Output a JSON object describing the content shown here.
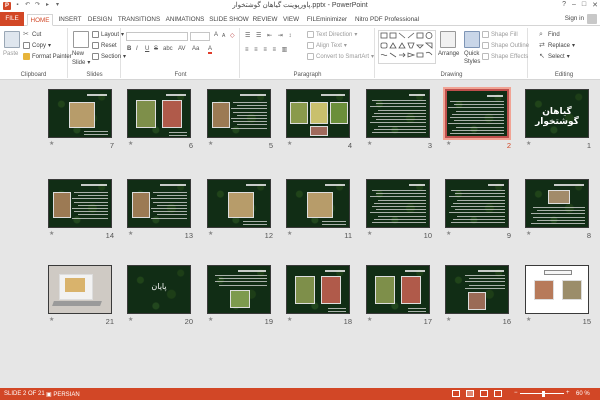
{
  "window": {
    "title": "پاورپوینت گیاهان گوشتخوار.pptx - PowerPoint",
    "controls": [
      "?",
      "–",
      "□",
      "✕"
    ]
  },
  "tabs": {
    "items": [
      "FILE",
      "HOME",
      "INSERT",
      "DESIGN",
      "TRANSITIONS",
      "ANIMATIONS",
      "SLIDE SHOW",
      "REVIEW",
      "VIEW",
      "FILEminimizer",
      "Nitro PDF Professional"
    ],
    "active": "HOME",
    "sign_in": "Sign in"
  },
  "ribbon": {
    "clipboard": {
      "label": "Clipboard",
      "paste": "Paste",
      "cut": "Cut",
      "copy": "Copy",
      "format_painter": "Format Painter"
    },
    "slides": {
      "label": "Slides",
      "new_slide": "New",
      "new_slide2": "Slide",
      "layout": "Layout",
      "reset": "Reset",
      "section": "Section"
    },
    "font": {
      "label": "Font",
      "bold": "B",
      "italic": "I",
      "underline": "U",
      "strike": "S",
      "shadow": "abc",
      "aa": "AV",
      "case": "Aa",
      "grow": "A",
      "shrink": "A"
    },
    "paragraph": {
      "label": "Paragraph",
      "text_direction": "Text Direction",
      "align_text": "Align Text",
      "smartart": "Convert to SmartArt"
    },
    "drawing": {
      "label": "Drawing",
      "arrange": "Arrange",
      "quick_styles": "Quick",
      "quick_styles2": "Styles",
      "shape_fill": "Shape Fill",
      "shape_outline": "Shape Outline",
      "shape_effects": "Shape Effects"
    },
    "editing": {
      "label": "Editing",
      "find": "Find",
      "replace": "Replace",
      "select": "Select"
    }
  },
  "slides": [
    {
      "n": "1",
      "kind": "title",
      "title": "گیاهان گوشتخوار",
      "selected": false
    },
    {
      "n": "2",
      "kind": "text",
      "selected": true
    },
    {
      "n": "3",
      "kind": "text",
      "selected": false
    },
    {
      "n": "4",
      "kind": "images3",
      "selected": false
    },
    {
      "n": "5",
      "kind": "image-text",
      "selected": false
    },
    {
      "n": "6",
      "kind": "images2",
      "selected": false
    },
    {
      "n": "7",
      "kind": "image-center",
      "selected": false
    },
    {
      "n": "8",
      "kind": "image-top",
      "selected": false
    },
    {
      "n": "9",
      "kind": "text",
      "selected": false
    },
    {
      "n": "10",
      "kind": "text",
      "selected": false
    },
    {
      "n": "11",
      "kind": "image-center",
      "selected": false
    },
    {
      "n": "12",
      "kind": "image-center",
      "selected": false
    },
    {
      "n": "13",
      "kind": "image-text",
      "selected": false
    },
    {
      "n": "14",
      "kind": "image-text",
      "selected": false
    },
    {
      "n": "15",
      "kind": "light",
      "selected": false
    },
    {
      "n": "16",
      "kind": "text-image",
      "selected": false
    },
    {
      "n": "17",
      "kind": "images2",
      "selected": false
    },
    {
      "n": "18",
      "kind": "images2",
      "selected": false
    },
    {
      "n": "19",
      "kind": "image-bottom",
      "selected": false
    },
    {
      "n": "20",
      "kind": "bye",
      "title": "پایان",
      "selected": false
    },
    {
      "n": "21",
      "kind": "laptop",
      "selected": false
    }
  ],
  "status": {
    "slide_info": "SLIDE 2 OF 21",
    "language": "PERSIAN",
    "zoom": "60 %"
  },
  "colors": {
    "accent": "#d24726",
    "sorter_bg": "#e6e6e6",
    "slide_bg": "#0f2a10",
    "selection": "#c0504d"
  }
}
